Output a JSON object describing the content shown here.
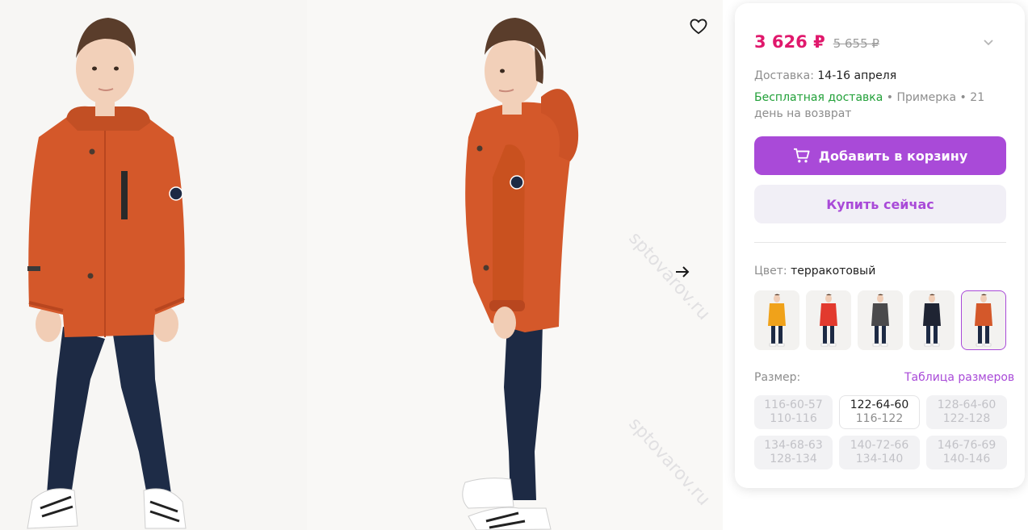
{
  "gallery": {
    "favorite_icon": "heart-outline-icon",
    "next_icon": "arrow-right-icon",
    "watermark": "sptovarov.ru"
  },
  "price": {
    "current": "3 626 ₽",
    "old": "5 655 ₽"
  },
  "delivery": {
    "label": "Доставка:",
    "dates": "14-16 апреля"
  },
  "perks": {
    "free_delivery": "Бесплатная доставка",
    "sep": " • ",
    "fitting": "Примерка",
    "return": "21 день на возврат"
  },
  "buttons": {
    "add_to_cart": "Добавить в корзину",
    "buy_now": "Купить сейчас"
  },
  "color": {
    "label": "Цвет:",
    "value": "терракотовый",
    "swatches": [
      {
        "jacket": "#f0a21a"
      },
      {
        "jacket": "#e23a2e"
      },
      {
        "jacket": "#4a4a4c"
      },
      {
        "jacket": "#1f2433"
      },
      {
        "jacket": "#d4582a"
      }
    ]
  },
  "size": {
    "label": "Размер:",
    "table_link": "Таблица размеров",
    "options": [
      {
        "a": "116-60-57",
        "b": "110-116",
        "available": false
      },
      {
        "a": "122-64-60",
        "b": "116-122",
        "available": true
      },
      {
        "a": "128-64-60",
        "b": "122-128",
        "available": false
      },
      {
        "a": "134-68-63",
        "b": "128-134",
        "available": false
      },
      {
        "a": "140-72-66",
        "b": "134-140",
        "available": false
      },
      {
        "a": "146-76-69",
        "b": "140-146",
        "available": false
      }
    ]
  },
  "colors": {
    "accent": "#a94ad8",
    "price": "#e0186c",
    "green": "#21a038",
    "jacket": "#d4582a"
  }
}
